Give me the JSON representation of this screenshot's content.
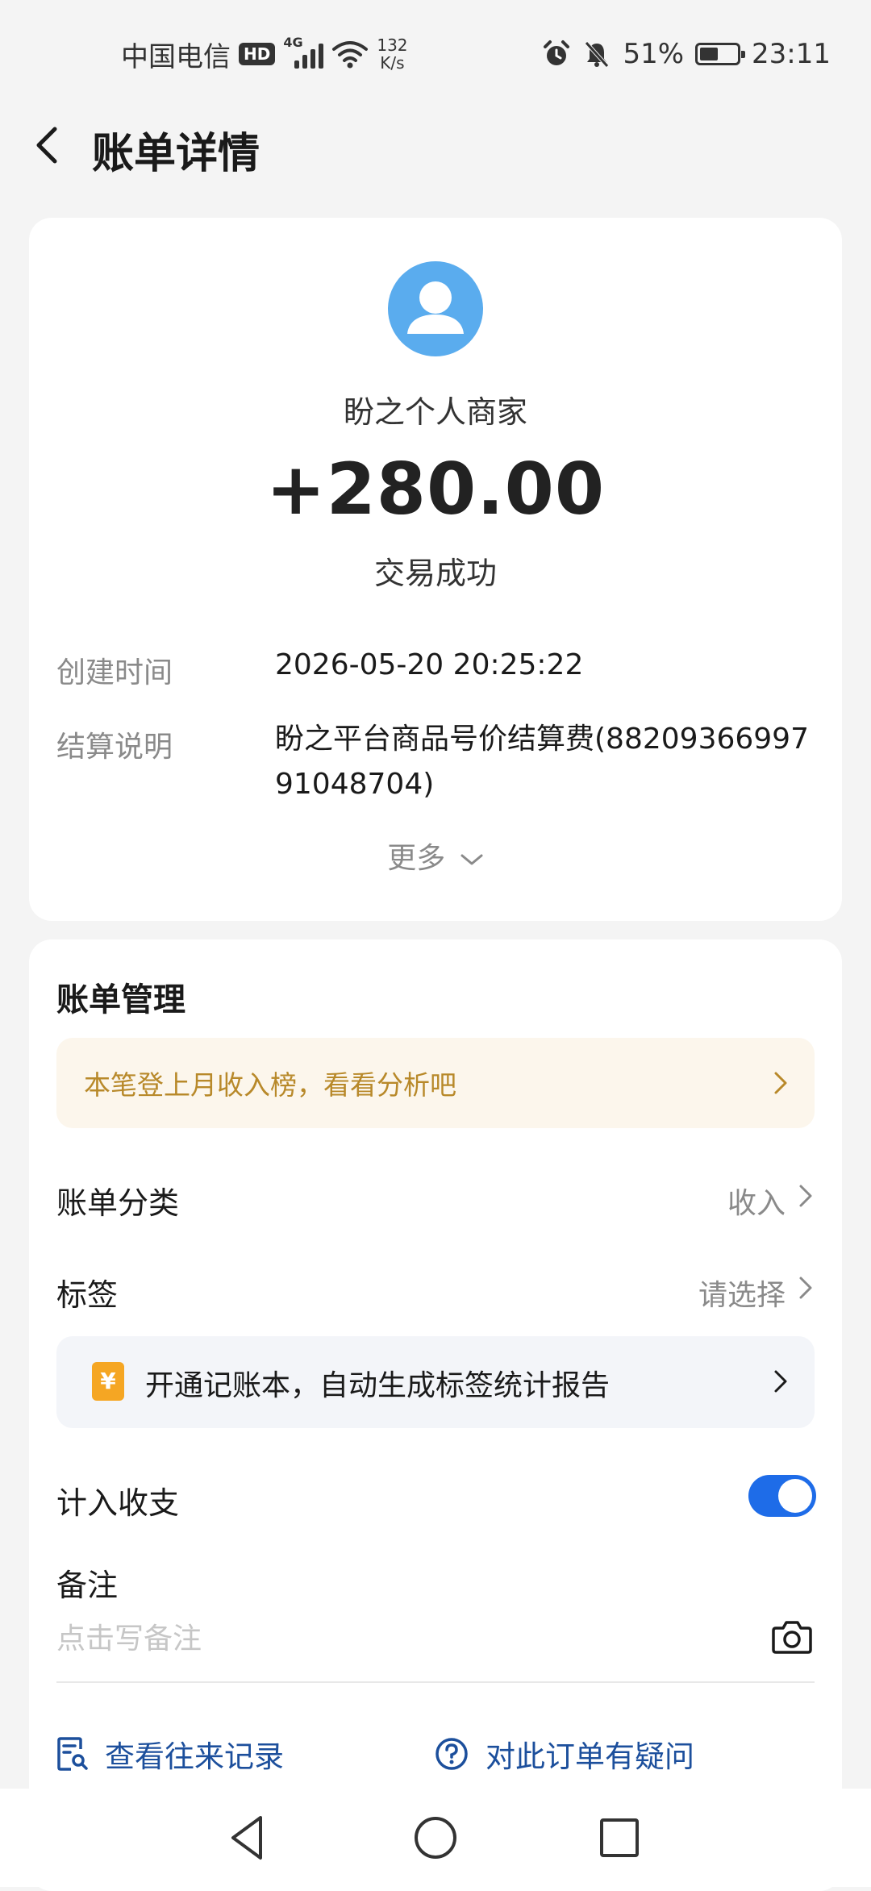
{
  "status_bar": {
    "carrier": "中国电信",
    "hd": "HD",
    "network": "4G",
    "speed_value": "132",
    "speed_unit": "K/s",
    "battery": "51%",
    "battery_level": 0.51,
    "time": "23:11"
  },
  "header": {
    "title": "账单详情"
  },
  "summary": {
    "merchant": "盼之个人商家",
    "amount": "+280.00",
    "status": "交易成功",
    "created_label": "创建时间",
    "created_value": "2026-05-20 20:25:22",
    "settle_label": "结算说明",
    "settle_value": "盼之平台商品号价结算费(8820936699791048704)",
    "more_label": "更多"
  },
  "management": {
    "title": "账单管理",
    "promo_text": "本笔登上月收入榜，看看分析吧",
    "category_label": "账单分类",
    "category_value": "收入",
    "tag_label": "标签",
    "tag_value": "请选择",
    "notebook_icon": "¥",
    "notebook_text": "开通记账本，自动生成标签统计报告",
    "include_label": "计入收支",
    "include_on": true,
    "remark_label": "备注",
    "remark_placeholder": "点击写备注",
    "history_label": "查看往来记录",
    "question_label": "对此订单有疑问"
  },
  "colors": {
    "accent": "#1e6ce8",
    "link": "#1c4f9c",
    "promo_text": "#b8892a",
    "avatar": "#5aacee"
  }
}
